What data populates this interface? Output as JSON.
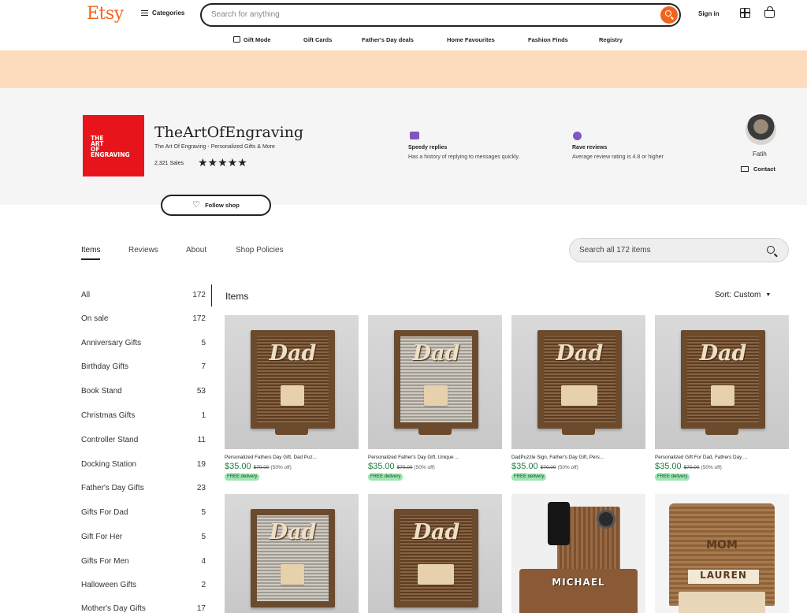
{
  "header": {
    "logo": "Etsy",
    "categories_label": "Categories",
    "search_placeholder": "Search for anything",
    "signin_label": "Sign in"
  },
  "subnav": {
    "items": [
      "Gift Mode",
      "Gift Cards",
      "Father's Day deals",
      "Home Favourites",
      "Fashion Finds",
      "Registry"
    ]
  },
  "shop": {
    "logo_lines": [
      "THE",
      "ART",
      "OF",
      "ENGRAVING"
    ],
    "name": "TheArtOfEngraving",
    "tagline": "The Art Of Engraving - Personalized Gifts & More",
    "sales": "2,321 Sales",
    "stars": "★★★★★",
    "badges": [
      {
        "title": "Speedy replies",
        "desc": "Has a history of replying to messages quickly."
      },
      {
        "title": "Rave reviews",
        "desc": "Average review rating is 4.8 or higher"
      }
    ],
    "owner_name": "Fatih",
    "contact_label": "Contact",
    "follow_label": "Follow shop"
  },
  "tabs": [
    "Items",
    "Reviews",
    "About",
    "Shop Policies"
  ],
  "shop_search_placeholder": "Search all 172 items",
  "sidebar": {
    "categories": [
      {
        "label": "All",
        "count": "172"
      },
      {
        "label": "On sale",
        "count": "172"
      },
      {
        "label": "Anniversary Gifts",
        "count": "5"
      },
      {
        "label": "Birthday Gifts",
        "count": "7"
      },
      {
        "label": "Book Stand",
        "count": "53"
      },
      {
        "label": "Christmas Gifts",
        "count": "1"
      },
      {
        "label": "Controller Stand",
        "count": "11"
      },
      {
        "label": "Docking Station",
        "count": "19"
      },
      {
        "label": "Father's Day Gifts",
        "count": "23"
      },
      {
        "label": "Gifts For Dad",
        "count": "5"
      },
      {
        "label": "Gift For Her",
        "count": "5"
      },
      {
        "label": "Gifts For Men",
        "count": "4"
      },
      {
        "label": "Halloween Gifts",
        "count": "2"
      },
      {
        "label": "Mother's Day Gifts",
        "count": "17"
      }
    ]
  },
  "items_title": "Items",
  "sort_label": "Sort: Custom",
  "products": [
    {
      "title": "Personalized Fathers Day Gift, Dad Puz...",
      "price": "$35.00",
      "orig": "$70.00",
      "off": "(50% off)",
      "badge": "FREE delivery",
      "image_word": "Dad"
    },
    {
      "title": "Personalized Father's Day Gift, Unique ...",
      "price": "$35.00",
      "orig": "$70.00",
      "off": "(50% off)",
      "badge": "FREE delivery",
      "image_word": "Dad"
    },
    {
      "title": "DadPuzzle Sign, Father's Day Gift, Pers...",
      "price": "$35.00",
      "orig": "$70.00",
      "off": "(50% off)",
      "badge": "FREE delivery",
      "image_word": "Dad"
    },
    {
      "title": "Personalized Gift For Dad, Fathers Day ...",
      "price": "$35.00",
      "orig": "$70.00",
      "off": "(50% off)",
      "badge": "FREE delivery",
      "image_word": "Dad"
    },
    {
      "image_word": "Dad"
    },
    {
      "image_word": "Dad"
    },
    {
      "image_word": "MICHAEL"
    },
    {
      "image_word": "MOM",
      "image_name": "LAUREN"
    }
  ]
}
